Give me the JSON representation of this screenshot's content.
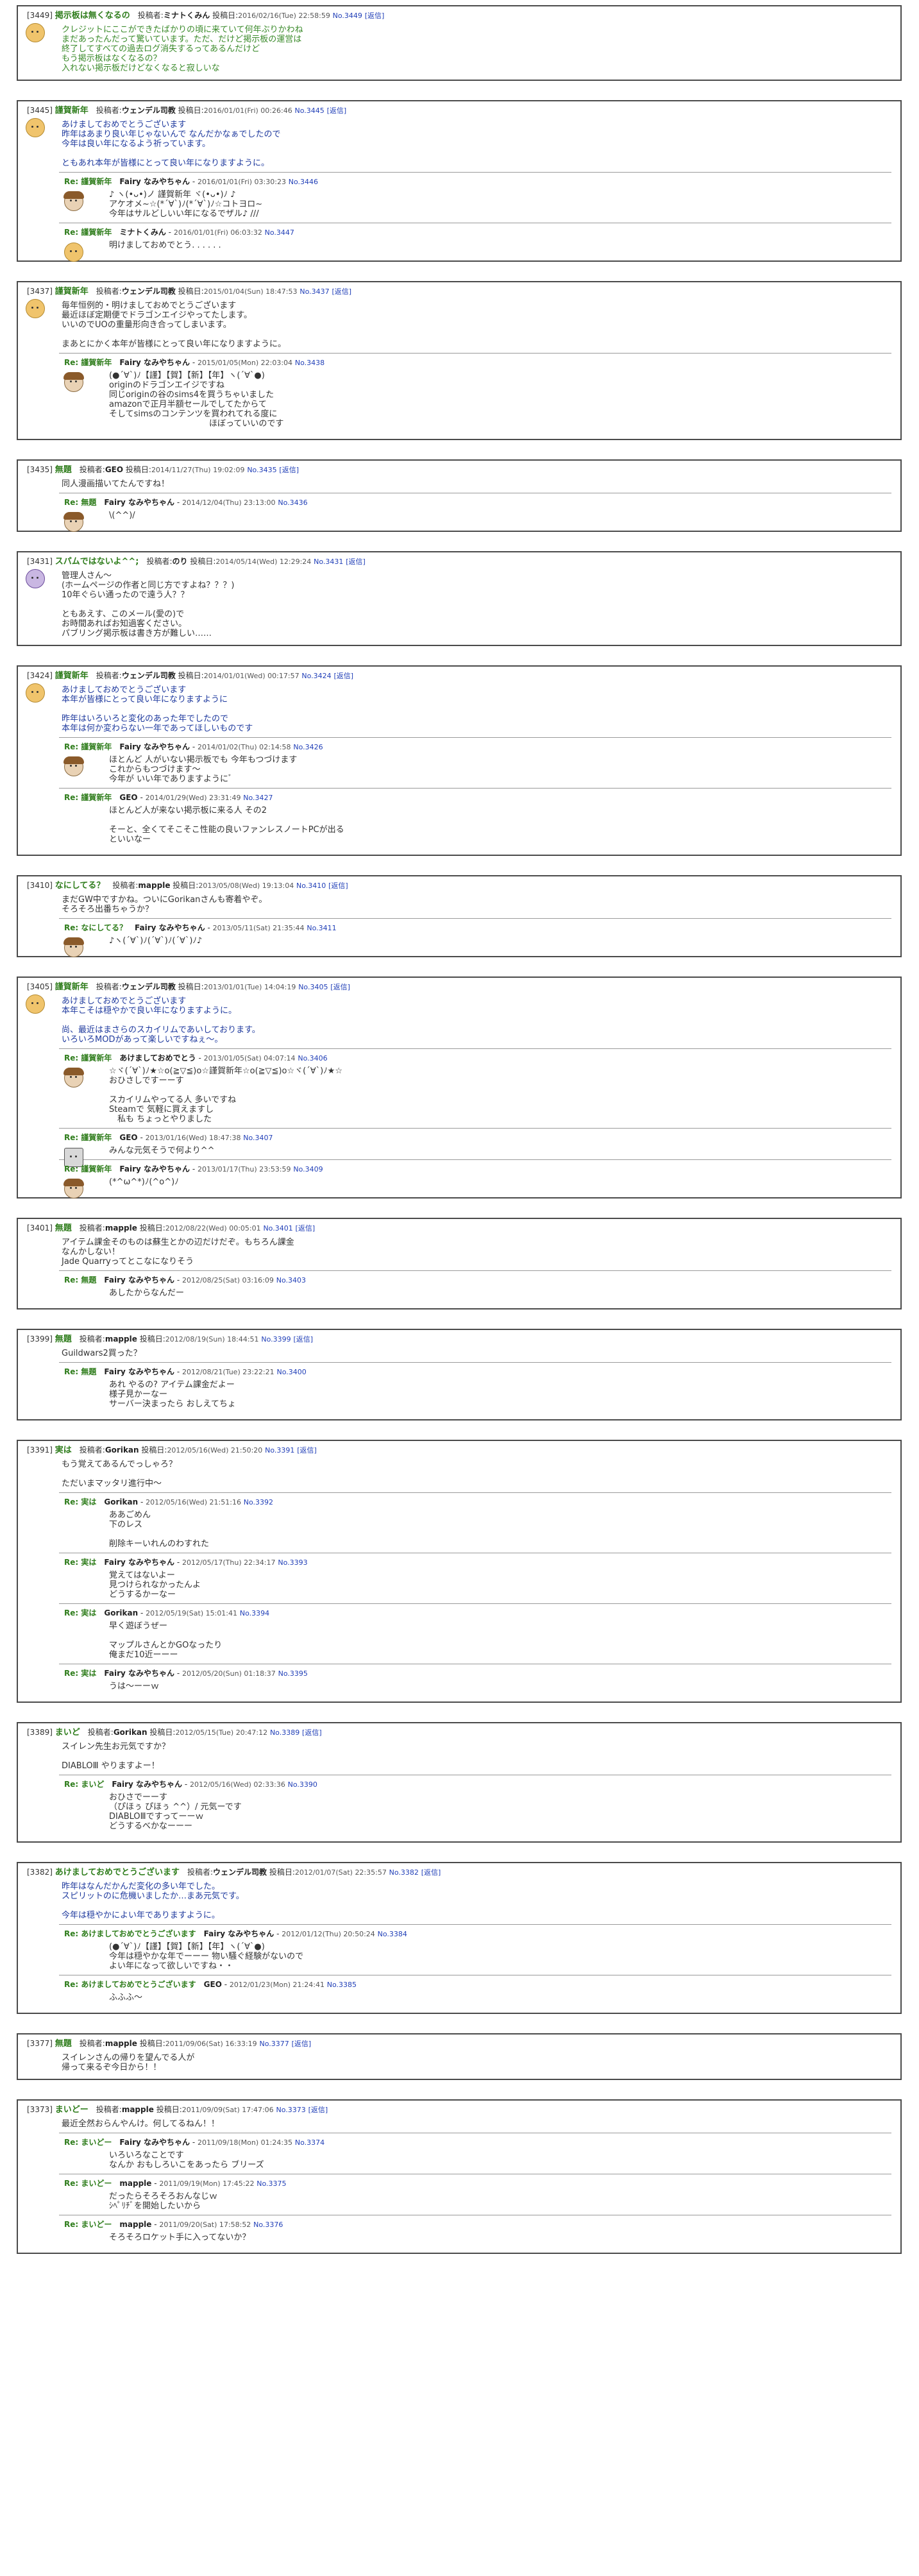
{
  "labels": {
    "poster": "投稿者:",
    "posted": "投稿日:",
    "reply": "[返信]"
  },
  "posts": [
    {
      "num": "[3449]",
      "subject": "掲示板は無くなるの",
      "author": "ミナトくみん",
      "date": "2016/02/16(Tue) 22:58:59",
      "no": "No.3449",
      "avatar": "sun",
      "bodyColor": "green",
      "body": "クレジットにここができたばかりの頃に来ていて何年ぶりかわね\nまだあったんだって驚いています。ただ、だけど掲示板の運営は\n終了してすべての過去ログ消失するってあるんだけど\nもう掲示板はなくなるの？\n入れない掲示板だけどなくなると寂しいな",
      "replies": []
    },
    {
      "num": "[3445]",
      "subject": "謹賀新年",
      "author": "ウェンデル司教",
      "date": "2016/01/01(Fri) 00:26:46",
      "no": "No.3445",
      "avatar": "sun",
      "bodyColor": "blue",
      "body": "あけましておめでとうございます\n昨年はあまり良い年じゃないんで なんだかなぁでしたので\n今年は良い年になるよう祈っています。\n\nともあれ本年が皆様にとって良い年になりますように。",
      "replies": [
        {
          "subject": "Re: 謹賀新年",
          "author": "Fairy なみやちゃん",
          "date": "2016/01/01(Fri) 03:30:23",
          "no": "No.3446",
          "avatar": "girl",
          "body": "♪ ヽ(•ᴗ•)ノ 謹賀新年 ヾ(•ᴗ•)ﾉ ♪\nアケオメ~☆(*´∀`)ﾉ(*´∀`)ﾉ☆コトヨロ~\n今年はサルどしいい年になるでザル♪ ///"
        },
        {
          "subject": "Re: 謹賀新年",
          "author": "ミナトくみん",
          "date": "2016/01/01(Fri) 06:03:32",
          "no": "No.3447",
          "avatar": "sun",
          "body": "明けましておめでとう. . . . . ."
        }
      ]
    },
    {
      "num": "[3437]",
      "subject": "謹賀新年",
      "author": "ウェンデル司教",
      "date": "2015/01/04(Sun) 18:47:53",
      "no": "No.3437",
      "avatar": "sun",
      "bodyColor": "plain",
      "body": "毎年恒例的・明けましておめでとうございます\n最近ほぼ定期便でドラゴンエイジやってたします。\nいいのでUOの重量形向き合ってしまいます。\n\nまあとにかく本年が皆様にとって良い年になりますように。",
      "replies": [
        {
          "subject": "Re: 謹賀新年",
          "author": "Fairy なみやちゃん",
          "date": "2015/01/05(Mon) 22:03:04",
          "no": "No.3438",
          "avatar": "girl",
          "body": "(●´∀`)ﾉ【謹】【賀】【新】【年】ヽ(´∀`●)\noriginのドラゴンエイジですね\n同じoriginの谷のsims4を買うちゃいました\namazonで正月半額セールでしてたからて\nそしてsimsのコンテンツを買われてれる度に\n　　　　　　　　　　　　ほぼっていいのです"
        }
      ]
    },
    {
      "num": "[3435]",
      "subject": "無題",
      "author": "GEO",
      "date": "2014/11/27(Thu) 19:02:09",
      "no": "No.3435",
      "avatar": "none",
      "bodyColor": "plain",
      "body": "同人漫画描いてたんですね！",
      "replies": [
        {
          "subject": "Re: 無題",
          "author": "Fairy なみやちゃん",
          "date": "2014/12/04(Thu) 23:13:00",
          "no": "No.3436",
          "avatar": "girl",
          "body": "\\(^^)/"
        }
      ]
    },
    {
      "num": "[3431]",
      "subject": "スパムではないよ^^;",
      "author": "のり",
      "date": "2014/05/14(Wed) 12:29:24",
      "no": "No.3431",
      "avatar": "round",
      "bodyColor": "plain",
      "body": "管理人さん～\n(ホームページの作者と同じ方ですよね？？？)\n10年ぐらい通ったので遠う人？？\n\nともあえす、このメール(愛の)で\nお時間あればお知過客ください。\nパブリング掲示板は書き方が難しい……",
      "replies": []
    },
    {
      "num": "[3424]",
      "subject": "謹賀新年",
      "author": "ウェンデル司教",
      "date": "2014/01/01(Wed) 00:17:57",
      "no": "No.3424",
      "avatar": "sun",
      "bodyColor": "blue",
      "body": "あけましておめでとうございます\n本年が皆様にとって良い年になりますように\n\n昨年はいろいろと変化のあった年でしたので\n本年は何か変わらない一年であってほしいものです",
      "replies": [
        {
          "subject": "Re: 謹賀新年",
          "author": "Fairy なみやちゃん",
          "date": "2014/01/02(Thu) 02:14:58",
          "no": "No.3426",
          "avatar": "girl",
          "body": "ほとんど 人がいない掲示板でも 今年もつづけます\nこれからもつづけます～\n今年が いい年でありますようにﾞ"
        },
        {
          "subject": "Re: 謹賀新年",
          "author": "GEO",
          "date": "2014/01/29(Wed) 23:31:49",
          "no": "No.3427",
          "avatar": "none",
          "body": "ほとんど人が来ない掲示板に来る人 その2\n\nそーと、全くてそこそこ性能の良いファンレスノートPCが出る\nといいなー"
        }
      ]
    },
    {
      "num": "[3410]",
      "subject": "なにしてる？",
      "author": "mapple",
      "date": "2013/05/08(Wed) 19:13:04",
      "no": "No.3410",
      "avatar": "none",
      "bodyColor": "plain",
      "body": "まだGW中ですかね。ついにGorikanさんも寄着やぞ。\nそろそろ出番ちゃうか？",
      "replies": [
        {
          "subject": "Re: なにしてる？",
          "author": "Fairy なみやちゃん",
          "date": "2013/05/11(Sat) 21:35:44",
          "no": "No.3411",
          "avatar": "girl",
          "body": "♪ヽ(´∀`)ﾉ(´∀`)ﾉ(´∀`)ﾉ♪"
        }
      ]
    },
    {
      "num": "[3405]",
      "subject": "謹賀新年",
      "author": "ウェンデル司教",
      "date": "2013/01/01(Tue) 14:04:19",
      "no": "No.3405",
      "avatar": "sun",
      "bodyColor": "blue",
      "body": "あけましておめでとうございます\n本年こそは穏やかで良い年になりますように。\n\n尚、最近はまさらのスカイリムであいしております。\nいろいろMODがあって楽しいですねぇ～。",
      "replies": [
        {
          "subject": "Re: 謹賀新年",
          "author": "あけましておめでとう",
          "date": "2013/01/05(Sat) 04:07:14",
          "no": "No.3406",
          "avatar": "girl",
          "body": "☆ヾ(´∀`)ﾉ★☆o(≧▽≦)o☆謹賀新年☆o(≧▽≦)o☆ヾ(´∀`)ﾉ★☆\nおひさしですーーす\n\nスカイリムやってる人 多いですね\nSteamで 気軽に買えますし\n　私も ちょっとやりました"
        },
        {
          "subject": "Re: 謹賀新年",
          "author": "GEO",
          "date": "2013/01/16(Wed) 18:47:38",
          "no": "No.3407",
          "avatar": "robot",
          "body": "みんな元気そうで何より^^"
        },
        {
          "subject": "Re: 謹賀新年",
          "author": "Fairy なみやちゃん",
          "date": "2013/01/17(Thu) 23:53:59",
          "no": "No.3409",
          "avatar": "girl",
          "body": "(*^ω^*)ﾉ(^o^)ﾉ"
        }
      ]
    },
    {
      "num": "[3401]",
      "subject": "無題",
      "author": "mapple",
      "date": "2012/08/22(Wed) 00:05:01",
      "no": "No.3401",
      "avatar": "none",
      "bodyColor": "plain",
      "body": "アイテム課金そのものは蘇生とかの辺だけだぞ。もちろん課金\nなんかしない！\nJade Quarryってとこなになりそう",
      "replies": [
        {
          "subject": "Re: 無題",
          "author": "Fairy なみやちゃん",
          "date": "2012/08/25(Sat) 03:16:09",
          "no": "No.3403",
          "avatar": "none",
          "body": "あしたからなんだー"
        }
      ]
    },
    {
      "num": "[3399]",
      "subject": "無題",
      "author": "mapple",
      "date": "2012/08/19(Sun) 18:44:51",
      "no": "No.3399",
      "avatar": "none",
      "bodyColor": "plain",
      "body": "Guildwars2買った？",
      "replies": [
        {
          "subject": "Re: 無題",
          "author": "Fairy なみやちゃん",
          "date": "2012/08/21(Tue) 23:22:21",
          "no": "No.3400",
          "avatar": "none",
          "body": "あれ やるの? アイテム課金だよー\n様子見かーなー\nサーバー決まったら おしえてちょ"
        }
      ]
    },
    {
      "num": "[3391]",
      "subject": "実は",
      "author": "Gorikan",
      "date": "2012/05/16(Wed) 21:50:20",
      "no": "No.3391",
      "avatar": "none",
      "bodyColor": "plain",
      "body": "もう覚えてあるんでっしゃろ？\n\nただいまマッタリ進行中～",
      "replies": [
        {
          "subject": "Re: 実は",
          "author": "Gorikan",
          "date": "2012/05/16(Wed) 21:51:16",
          "no": "No.3392",
          "avatar": "none",
          "body": "ああごめん\n下のレス\n\n削除キーいれんのわすれた"
        },
        {
          "subject": "Re: 実は",
          "author": "Fairy なみやちゃん",
          "date": "2012/05/17(Thu) 22:34:17",
          "no": "No.3393",
          "avatar": "none",
          "body": "覚えてはないよー\n見つけられなかったんよ\nどうするかーなー"
        },
        {
          "subject": "Re: 実は",
          "author": "Gorikan",
          "date": "2012/05/19(Sat) 15:01:41",
          "no": "No.3394",
          "avatar": "none",
          "body": "早く遊ぼうぜー\n\nマップルさんとかGOなったり\n俺まだ10近ーーー"
        },
        {
          "subject": "Re: 実は",
          "author": "Fairy なみやちゃん",
          "date": "2012/05/20(Sun) 01:18:37",
          "no": "No.3395",
          "avatar": "none",
          "body": "うは～ーーｗ"
        }
      ]
    },
    {
      "num": "[3389]",
      "subject": "まいど",
      "author": "Gorikan",
      "date": "2012/05/15(Tue) 20:47:12",
      "no": "No.3389",
      "avatar": "none",
      "bodyColor": "plain",
      "body": "スイレン先生お元気ですか？\n\nDIABLOⅢ やりますよー！",
      "replies": [
        {
          "subject": "Re: まいど",
          "author": "Fairy なみやちゃん",
          "date": "2012/05/16(Wed) 02:33:36",
          "no": "No.3390",
          "avatar": "none",
          "body": "おひさでーーす\n（ぴほぅ ぴほぅ ^^）/ 元気ーです\nDIABLOⅢですってーーｗ\nどうするべかなーーー"
        }
      ]
    },
    {
      "num": "[3382]",
      "subject": "あけましておめでとうございます",
      "author": "ウェンデル司教",
      "date": "2012/01/07(Sat) 22:35:57",
      "no": "No.3382",
      "avatar": "none",
      "bodyColor": "blue",
      "body": "昨年はなんだかんだ変化の多い年でした。\nスピリットのに危機いましたか…まあ元気です。\n\n今年は穏やかによい年でありますように。",
      "replies": [
        {
          "subject": "Re: あけましておめでとうございます",
          "author": "Fairy なみやちゃん",
          "date": "2012/01/12(Thu) 20:50:24",
          "no": "No.3384",
          "avatar": "none",
          "body": "(●´∀`)ﾉ【謹】【賀】【新】【年】ヽ(´∀`●)\n今年は穏やかな年でーーー 物い騒ぐ経験がないので\nよい年になって欲しいですね・・"
        },
        {
          "subject": "Re: あけましておめでとうございます",
          "author": "GEO",
          "date": "2012/01/23(Mon) 21:24:41",
          "no": "No.3385",
          "avatar": "none",
          "body": "ふふふ～"
        }
      ]
    },
    {
      "num": "[3377]",
      "subject": "無題",
      "author": "mapple",
      "date": "2011/09/06(Sat) 16:33:19",
      "no": "No.3377",
      "avatar": "none",
      "bodyColor": "plain",
      "body": "スイレンさんの帰りを望んでる人が\n帰って来るぞ今日から！！",
      "replies": []
    },
    {
      "num": "[3373]",
      "subject": "まいどー",
      "author": "mapple",
      "date": "2011/09/09(Sat) 17:47:06",
      "no": "No.3373",
      "avatar": "none",
      "bodyColor": "plain",
      "body": "最近全然おらんやんけ。何してるねん！！",
      "replies": [
        {
          "subject": "Re: まいどー",
          "author": "Fairy なみやちゃん",
          "date": "2011/09/18(Mon) 01:24:35",
          "no": "No.3374",
          "avatar": "none",
          "body": "いろいろなことです\nなんか おもしろいこをあったら ブリーズ"
        },
        {
          "subject": "Re: まいどー",
          "author": "mapple",
          "date": "2011/09/19(Mon) 17:45:22",
          "no": "No.3375",
          "avatar": "none",
          "body": "だったらそろそろおんなじｗ\nｼﾍﾟﾘﾁﾞを開始したいから"
        },
        {
          "subject": "Re: まいどー",
          "author": "mapple",
          "date": "2011/09/20(Sat) 17:58:52",
          "no": "No.3376",
          "avatar": "none",
          "body": "そろそろロケット手に入ってないか？"
        }
      ]
    }
  ]
}
